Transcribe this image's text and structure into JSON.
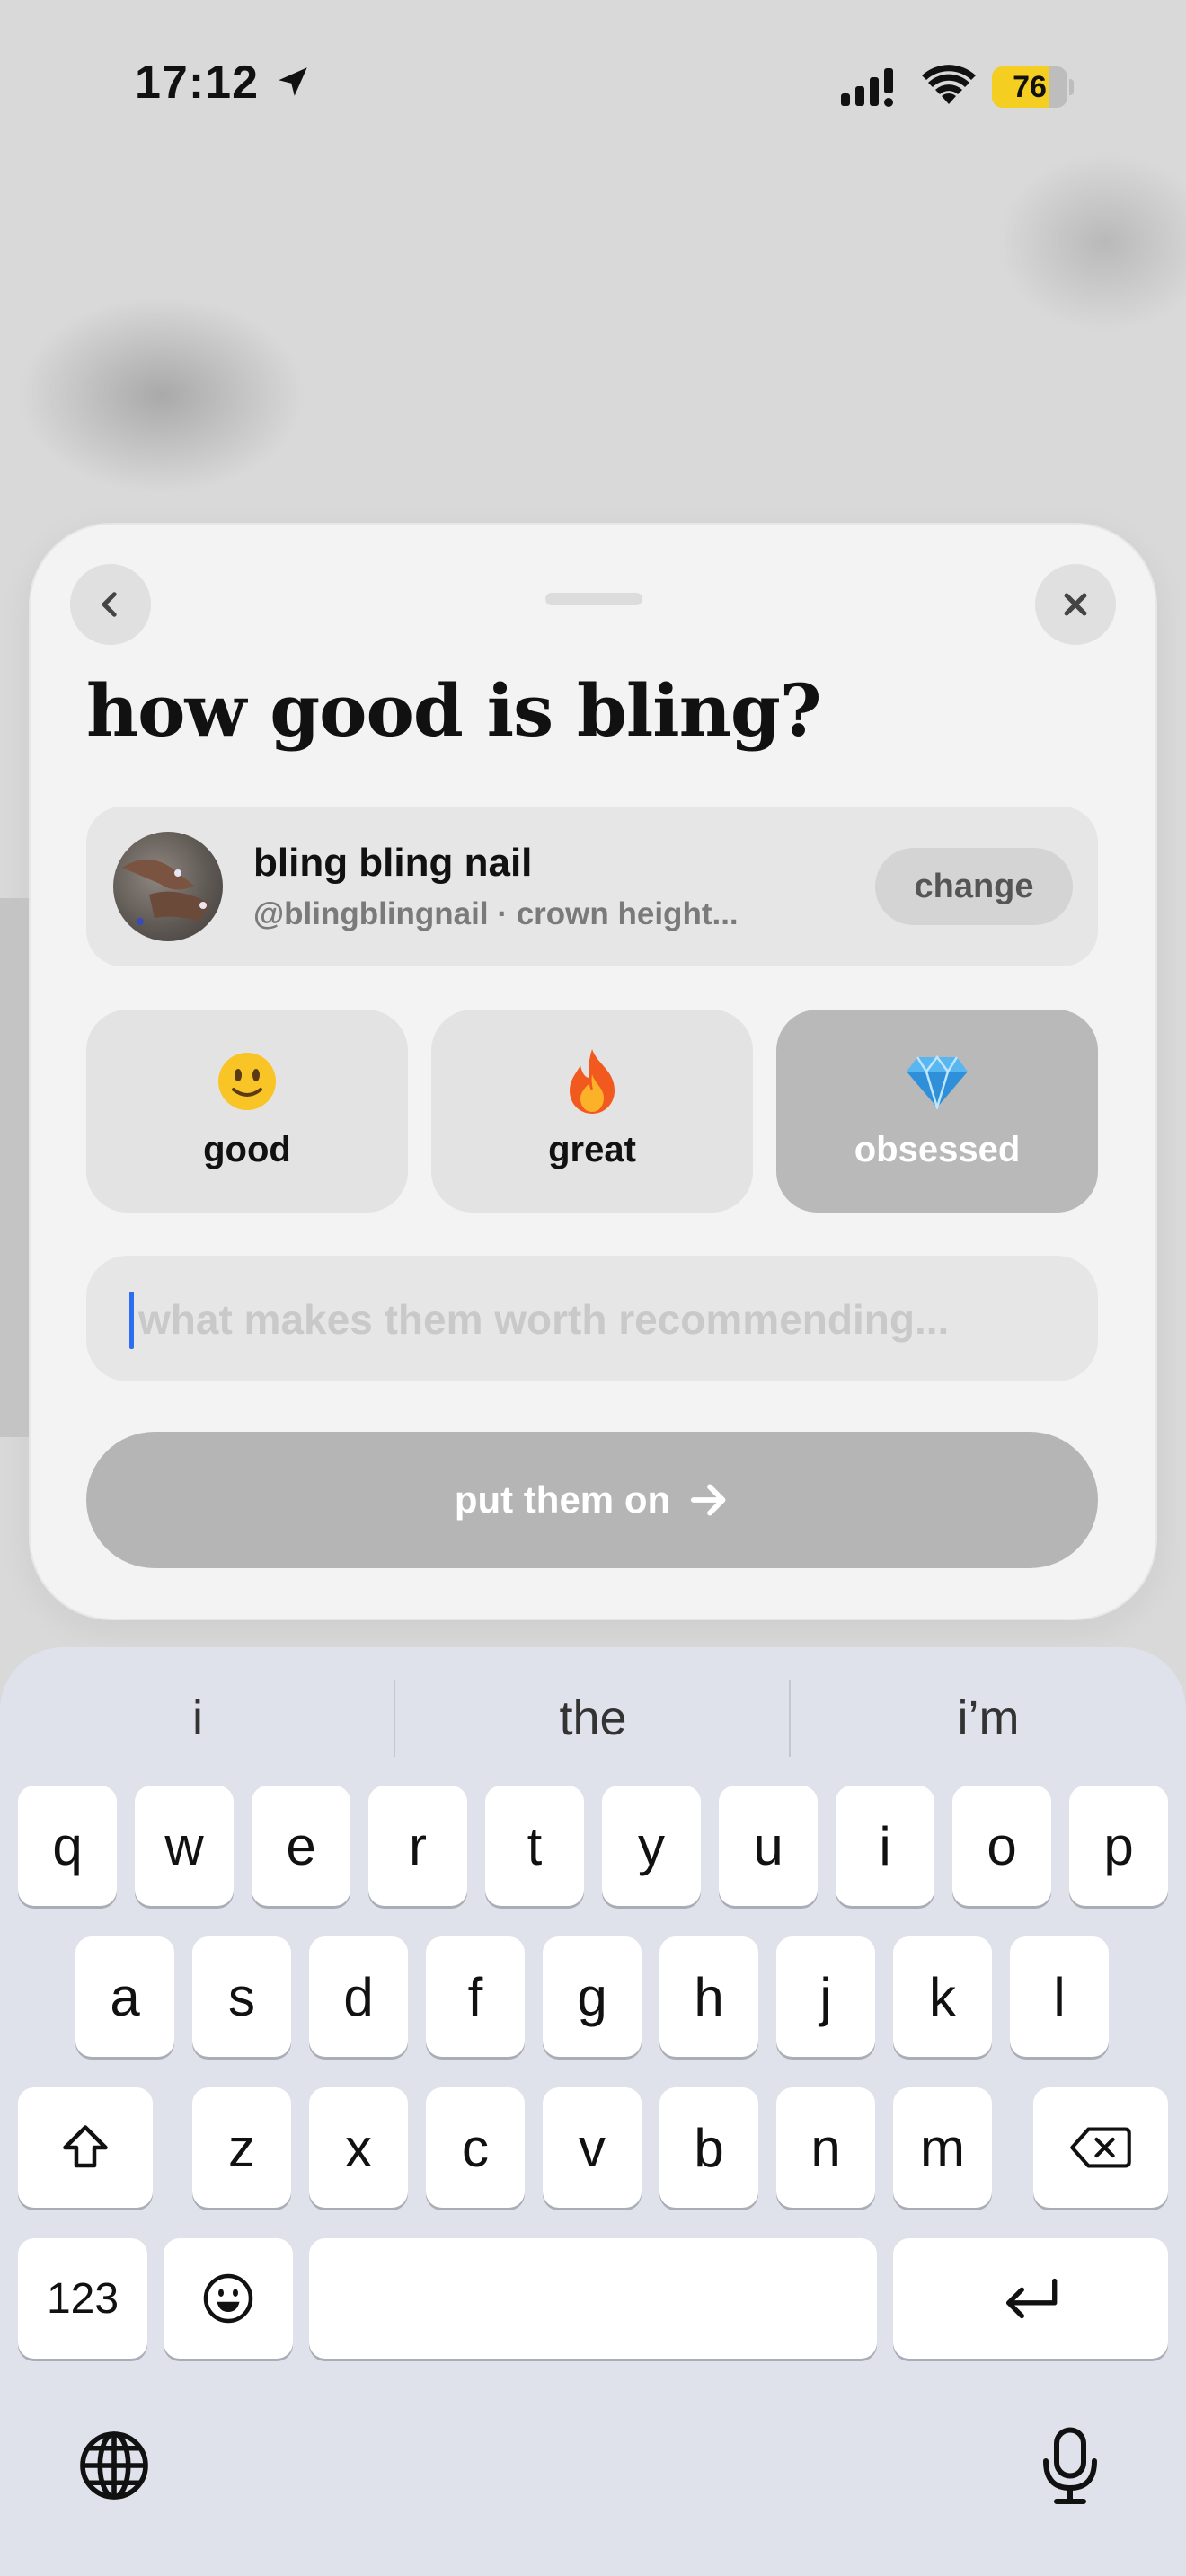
{
  "status_bar": {
    "time": "17:12",
    "battery": "76",
    "battery_level": 0.76
  },
  "sheet": {
    "title": "how good is bling?",
    "business": {
      "name": "bling bling nail",
      "subtitle": "@blingblingnail · crown height...",
      "change_label": "change"
    },
    "ratings": [
      {
        "label": "good",
        "emoji": "🙂",
        "selected": false
      },
      {
        "label": "great",
        "emoji": "🔥",
        "selected": false
      },
      {
        "label": "obsessed",
        "emoji": "💎",
        "selected": true
      }
    ],
    "comment_placeholder": "what makes them worth recommending...",
    "submit_label": "put them on"
  },
  "keyboard": {
    "suggestions": [
      "i",
      "the",
      "i’m"
    ],
    "rows": [
      [
        "q",
        "w",
        "e",
        "r",
        "t",
        "y",
        "u",
        "i",
        "o",
        "p"
      ],
      [
        "a",
        "s",
        "d",
        "f",
        "g",
        "h",
        "j",
        "k",
        "l"
      ],
      [
        "z",
        "x",
        "c",
        "v",
        "b",
        "n",
        "m"
      ]
    ],
    "numbers_label": "123"
  }
}
